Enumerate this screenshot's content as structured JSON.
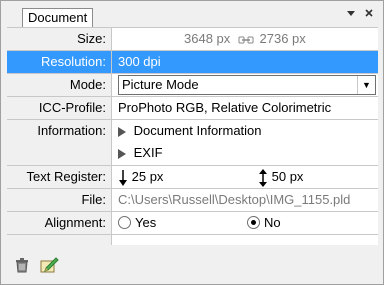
{
  "panel": {
    "tab_label": "Document",
    "pin_icon": "pin-icon",
    "close_icon": "close-icon"
  },
  "rows": {
    "size": {
      "label": "Size:",
      "width": "3648 px",
      "height": "2736 px"
    },
    "resolution": {
      "label": "Resolution:",
      "value": "300 dpi"
    },
    "mode": {
      "label": "Mode:",
      "value": "Picture Mode"
    },
    "icc": {
      "label": "ICC-Profile:",
      "value": "ProPhoto RGB, Relative Colorimetric"
    },
    "information": {
      "label": "Information:",
      "item1": "Document Information",
      "item2": "EXIF"
    },
    "text_register": {
      "label": "Text Register:",
      "value1": "25 px",
      "value2": "50 px"
    },
    "file": {
      "label": "File:",
      "value": "C:\\Users\\Russell\\Desktop\\IMG_1155.pld"
    },
    "alignment": {
      "label": "Alignment:",
      "option_yes": "Yes",
      "option_no": "No",
      "selected": "No"
    }
  },
  "footer": {
    "delete_icon": "trash-icon",
    "edit_icon": "edit-icon"
  },
  "colors": {
    "selection": "#3399ff",
    "grid_line": "#c8c8c8",
    "panel_bg": "#f0f0f0"
  }
}
